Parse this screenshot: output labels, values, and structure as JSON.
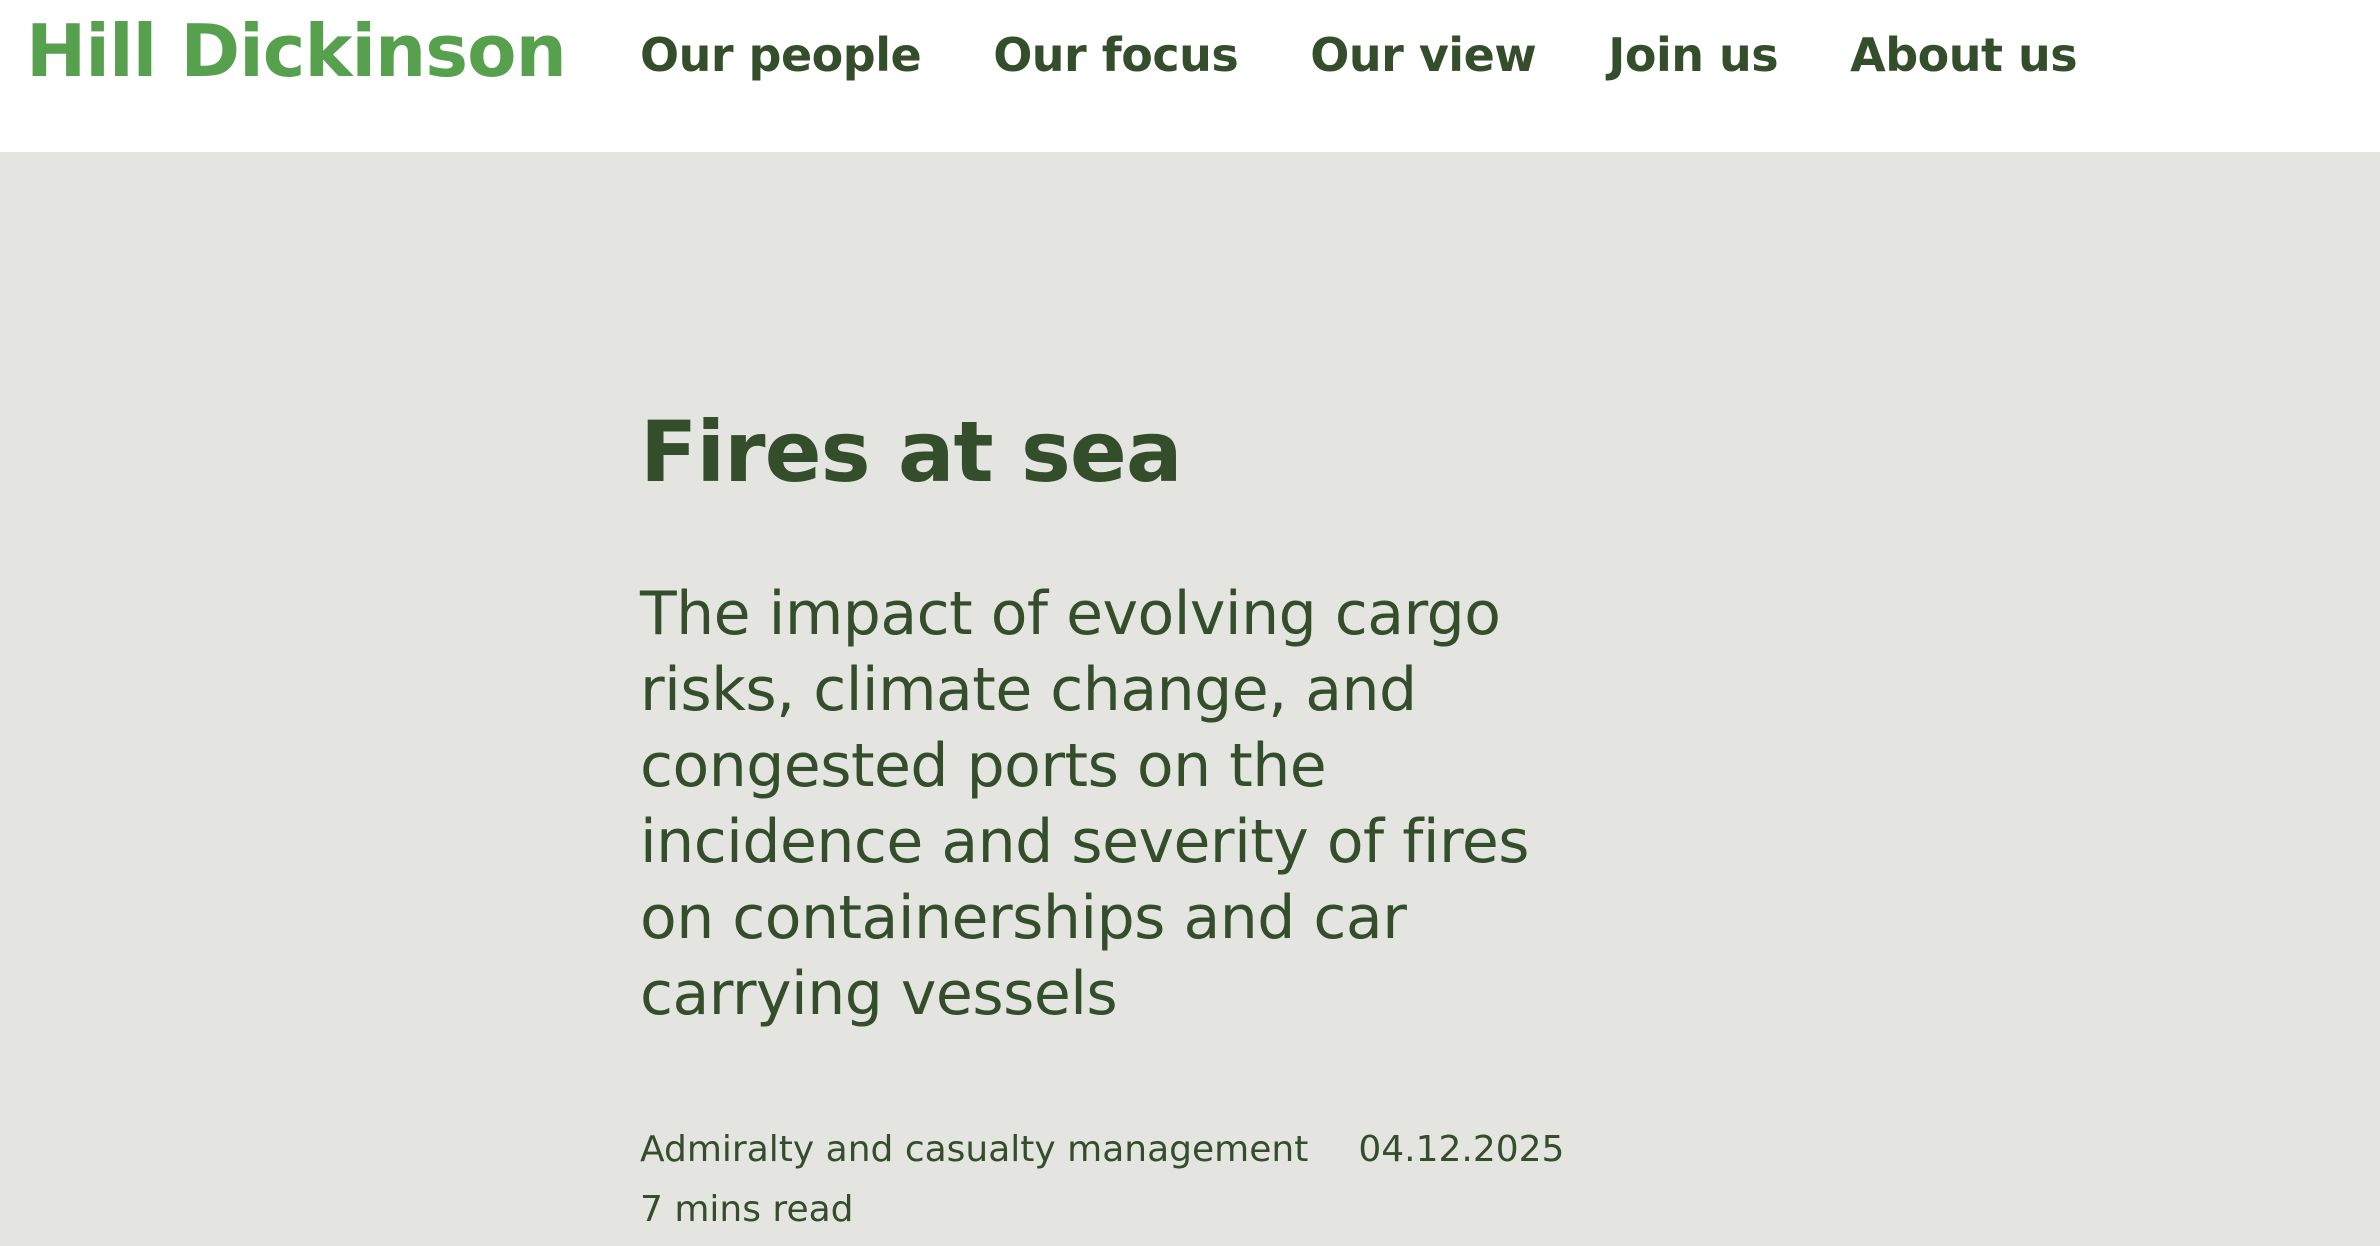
{
  "brand": {
    "name": "Hill Dickinson",
    "color": "#56a04e"
  },
  "nav": {
    "items": [
      {
        "label": "Our people"
      },
      {
        "label": "Our focus"
      },
      {
        "label": "Our view"
      },
      {
        "label": "Join us"
      },
      {
        "label": "About us"
      }
    ]
  },
  "article": {
    "title": "Fires at sea",
    "subtitle": "The impact of evolving cargo risks, climate change, and congested ports on the incidence and severity of fires on containerships and car carrying vessels",
    "category": "Admiralty and casualty management",
    "date": "04.12.2025",
    "read_time": "7 mins read"
  },
  "colors": {
    "text": "#344d2b",
    "hero_background": "#e4e5e1",
    "header_background": "#ffffff"
  }
}
